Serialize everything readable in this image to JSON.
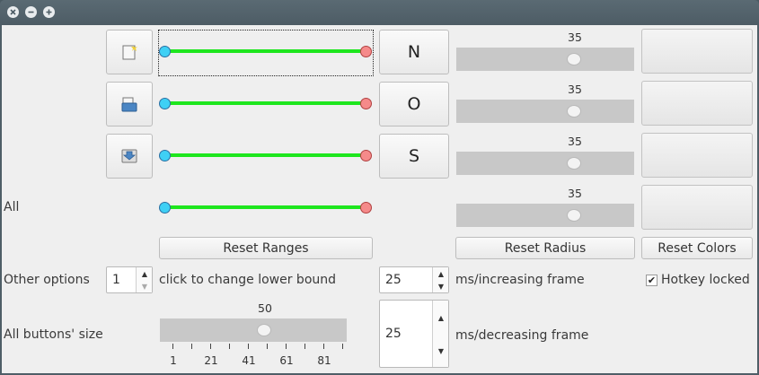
{
  "titlebar": {
    "buttons": [
      "close",
      "minimize",
      "maximize"
    ]
  },
  "rows": [
    {
      "icon": "new-file-icon",
      "letter": "N",
      "radius": "35"
    },
    {
      "icon": "open-folder-icon",
      "letter": "O",
      "radius": "35"
    },
    {
      "icon": "save-icon",
      "letter": "S",
      "radius": "35"
    },
    {
      "label": "All",
      "radius": "35"
    }
  ],
  "actions": {
    "reset_ranges": "Reset Ranges",
    "reset_radius": "Reset Radius",
    "reset_colors": "Reset Colors"
  },
  "other_options": {
    "label": "Other options",
    "lower_bound_value": "1",
    "lower_bound_hint": "click to change lower bound",
    "increasing_value": "25",
    "increasing_label": "ms/increasing frame",
    "hotkey_label": "Hotkey locked",
    "hotkey_checked": true
  },
  "buttons_size": {
    "label": "All buttons' size",
    "value": "50",
    "tick_labels": [
      "1",
      "21",
      "41",
      "61",
      "81"
    ],
    "decreasing_value": "25",
    "decreasing_label": "ms/decreasing frame"
  },
  "colors": {
    "range_track": "#1ee61e",
    "range_low_handle": "#3fd0f5",
    "range_high_handle": "#f58a8a",
    "titlebar": "#4f5e67"
  }
}
